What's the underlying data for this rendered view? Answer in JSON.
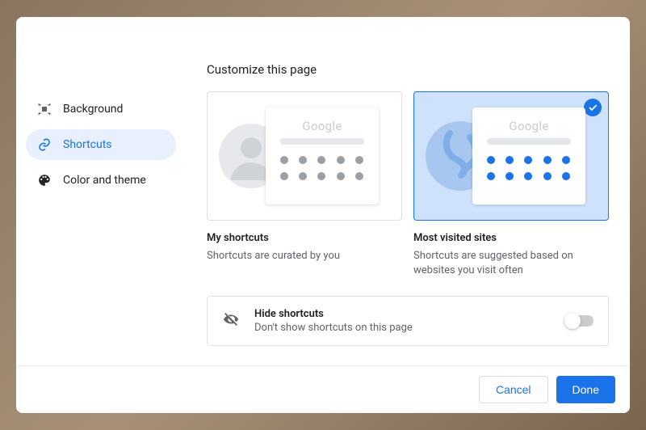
{
  "title": "Customize this page",
  "sidebar": {
    "items": [
      {
        "label": "Background",
        "active": false
      },
      {
        "label": "Shortcuts",
        "active": true
      },
      {
        "label": "Color and theme",
        "active": false
      }
    ]
  },
  "options": {
    "my_shortcuts": {
      "title": "My shortcuts",
      "description": "Shortcuts are curated by you",
      "selected": false,
      "logo": "Google"
    },
    "most_visited": {
      "title": "Most visited sites",
      "description": "Shortcuts are suggested based on websites you visit often",
      "selected": true,
      "logo": "Google"
    }
  },
  "hide": {
    "title": "Hide shortcuts",
    "description": "Don't show shortcuts on this page",
    "enabled": false
  },
  "buttons": {
    "cancel": "Cancel",
    "done": "Done"
  },
  "colors": {
    "accent": "#1a73e8",
    "selected_bg": "#cfe2fb"
  }
}
